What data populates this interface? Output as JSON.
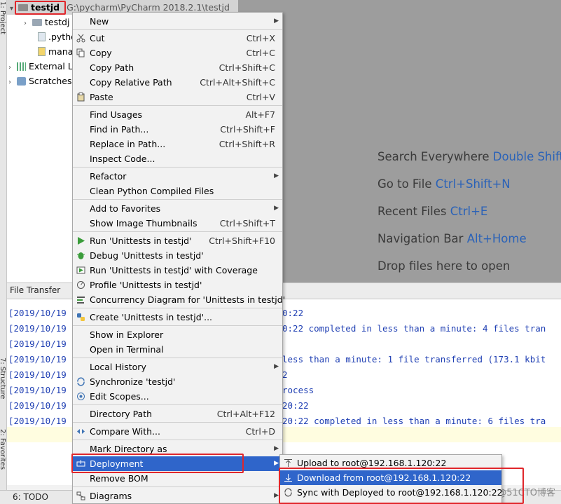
{
  "side_tabs": {
    "project": "1: Project",
    "structure": "7: Structure",
    "favorites": "2: Favorites"
  },
  "project": {
    "root_name": "testjd",
    "root_path": "G:\\pycharm\\PyCharm 2018.2.1\\testjd",
    "items": [
      {
        "label": "testdj",
        "icon": "folder-icon"
      },
      {
        "label": ".pytho",
        "icon": "file-icon"
      },
      {
        "label": "mana",
        "icon": "python-file-icon"
      },
      {
        "label": "External L",
        "icon": "library-icon"
      },
      {
        "label": "Scratches",
        "icon": "scratches-icon"
      }
    ]
  },
  "editor_hints": [
    {
      "text": "Search Everywhere",
      "key": "Double Shift"
    },
    {
      "text": "Go to File",
      "key": "Ctrl+Shift+N"
    },
    {
      "text": "Recent Files",
      "key": "Ctrl+E"
    },
    {
      "text": "Navigation Bar",
      "key": "Alt+Home"
    },
    {
      "text": "Drop files here to open",
      "key": ""
    }
  ],
  "file_transfer": {
    "tab_label": "File Transfer",
    "log_prefixes": [
      "[2019/10/19",
      "[2019/10/19",
      "[2019/10/19",
      "[2019/10/19",
      "[2019/10/19",
      "[2019/10/19",
      "[2019/10/19",
      "[2019/10/19"
    ],
    "log_tails": [
      "0:22",
      "0:22 completed in less than a minute: 4 files tran",
      "",
      "less than a minute: 1 file transferred (173.1 kbit",
      "2",
      "rocess",
      "20:22",
      "20:22 completed in less than a minute: 6 files tra"
    ]
  },
  "status_bar": {
    "todo": "6: TODO"
  },
  "watermark": "@51CTO博客",
  "context_menu": {
    "items": [
      {
        "label": "New",
        "shortcut": "",
        "submenu": true
      },
      {
        "label": "Cut",
        "shortcut": "Ctrl+X"
      },
      {
        "label": "Copy",
        "shortcut": "Ctrl+C"
      },
      {
        "label": "Copy Path",
        "shortcut": "Ctrl+Shift+C"
      },
      {
        "label": "Copy Relative Path",
        "shortcut": "Ctrl+Alt+Shift+C"
      },
      {
        "label": "Paste",
        "shortcut": "Ctrl+V"
      },
      {
        "label": "Find Usages",
        "shortcut": "Alt+F7"
      },
      {
        "label": "Find in Path...",
        "shortcut": "Ctrl+Shift+F"
      },
      {
        "label": "Replace in Path...",
        "shortcut": "Ctrl+Shift+R"
      },
      {
        "label": "Inspect Code...",
        "shortcut": ""
      },
      {
        "label": "Refactor",
        "shortcut": "",
        "submenu": true
      },
      {
        "label": "Clean Python Compiled Files",
        "shortcut": ""
      },
      {
        "label": "Add to Favorites",
        "shortcut": "",
        "submenu": true
      },
      {
        "label": "Show Image Thumbnails",
        "shortcut": "Ctrl+Shift+T"
      },
      {
        "label": "Run 'Unittests in testjd'",
        "shortcut": "Ctrl+Shift+F10"
      },
      {
        "label": "Debug 'Unittests in testjd'",
        "shortcut": ""
      },
      {
        "label": "Run 'Unittests in testjd' with Coverage",
        "shortcut": ""
      },
      {
        "label": "Profile 'Unittests in testjd'",
        "shortcut": ""
      },
      {
        "label": "Concurrency Diagram for 'Unittests in testjd'",
        "shortcut": ""
      },
      {
        "label": "Create 'Unittests in testjd'...",
        "shortcut": ""
      },
      {
        "label": "Show in Explorer",
        "shortcut": ""
      },
      {
        "label": "Open in Terminal",
        "shortcut": ""
      },
      {
        "label": "Local History",
        "shortcut": "",
        "submenu": true
      },
      {
        "label": "Synchronize 'testjd'",
        "shortcut": ""
      },
      {
        "label": "Edit Scopes...",
        "shortcut": ""
      },
      {
        "label": "Directory Path",
        "shortcut": "Ctrl+Alt+F12"
      },
      {
        "label": "Compare With...",
        "shortcut": "Ctrl+D"
      },
      {
        "label": "Mark Directory as",
        "shortcut": "",
        "submenu": true
      },
      {
        "label": "Deployment",
        "shortcut": "",
        "submenu": true
      },
      {
        "label": "Remove BOM",
        "shortcut": ""
      },
      {
        "label": "Diagrams",
        "shortcut": "",
        "submenu": true
      }
    ]
  },
  "deployment_submenu": {
    "items": [
      {
        "label": "Upload to root@192.168.1.120:22"
      },
      {
        "label": "Download from root@192.168.1.120:22"
      },
      {
        "label": "Sync with Deployed to root@192.168.1.120:22"
      }
    ]
  },
  "colors": {
    "highlight": "#2f65ca",
    "annotation_red": "#e0262b",
    "shortcut_key_blue": "#2a62b8",
    "log_text": "#1f3fb3"
  }
}
